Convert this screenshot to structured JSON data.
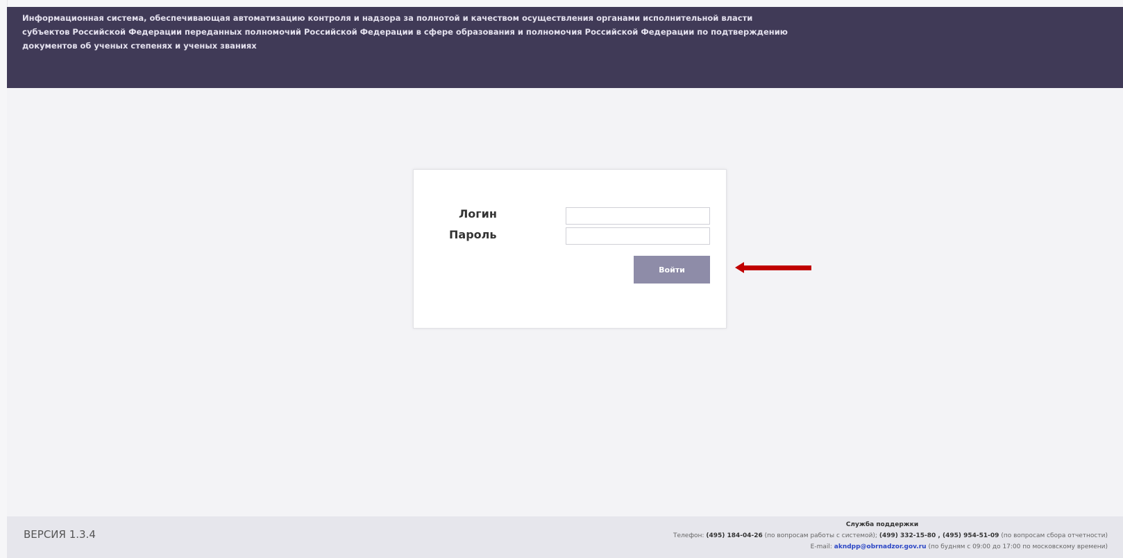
{
  "header": {
    "description": "Информационная система, обеспечивающая автоматизацию контроля и надзора за полнотой и качеством осуществления органами исполнительной власти субъектов Российской Федерации переданных полномочий Российской Федерации в сфере образования и полномочия Российской Федерации по подтверждению документов об ученых степенях и ученых званиях",
    "background_color": "#403a57"
  },
  "login_form": {
    "login_label": "Логин",
    "password_label": "Пароль",
    "login_value": "",
    "password_value": "",
    "submit_label": "Войти",
    "submit_color": "#8e8ca8"
  },
  "annotation": {
    "arrow_color": "#c00000",
    "arrow_icon": "left-arrow-icon"
  },
  "footer": {
    "version": "ВЕРСИЯ 1.3.4",
    "support_title": "Служба поддержки",
    "phone_prefix": "Телефон:",
    "phone_1": "(495) 184-04-26",
    "phone_1_note": "(по вопросам работы с системой);",
    "phone_2": "(499) 332-15-80 , (495) 954-51-09",
    "phone_2_note": "(по вопросам сбора отчетности)",
    "email_prefix": "E-mail:",
    "email": "akndpp@obrnadzor.gov.ru",
    "email_note": "(по будням с 09:00 до 17:00 по московскому времени)"
  }
}
